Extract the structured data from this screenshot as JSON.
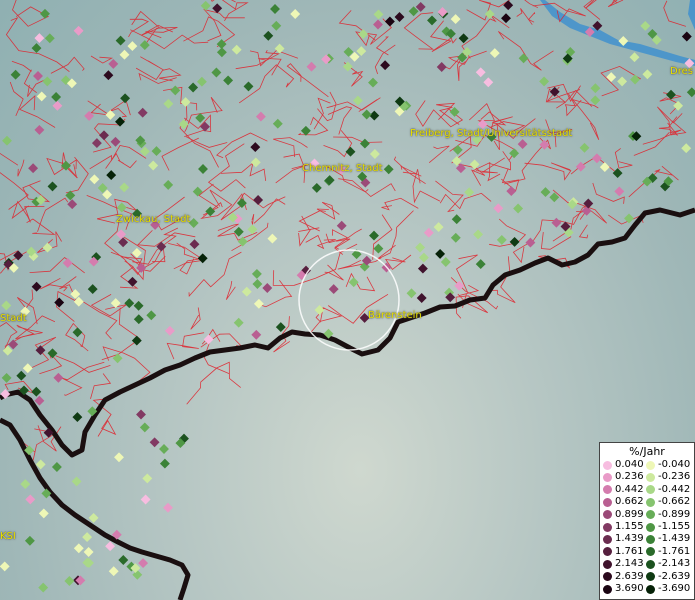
{
  "places": [
    {
      "id": "dresden",
      "label": "Dres"
    },
    {
      "id": "freiberg",
      "label": "Freiberg, Stadt/Universitätsstadt"
    },
    {
      "id": "chemnitz",
      "label": "Chemnitz, Stadt"
    },
    {
      "id": "zwickau",
      "label": "Zwickau, Stadt"
    },
    {
      "id": "baerenstein",
      "label": "Bärenstein"
    },
    {
      "id": "stadt-left",
      "label": "Stadt"
    },
    {
      "id": "ksi",
      "label": "KSI"
    }
  ],
  "legend": {
    "title": "%/Jahr",
    "positive": [
      {
        "value": "0.040",
        "color": "#f7bde0"
      },
      {
        "value": "0.236",
        "color": "#e99bc8"
      },
      {
        "value": "0.442",
        "color": "#d47cae"
      },
      {
        "value": "0.662",
        "color": "#b95f92"
      },
      {
        "value": "0.899",
        "color": "#9b4a78"
      },
      {
        "value": "1.155",
        "color": "#823a63"
      },
      {
        "value": "1.439",
        "color": "#6b2c50"
      },
      {
        "value": "1.761",
        "color": "#561f3e"
      },
      {
        "value": "2.143",
        "color": "#40132d"
      },
      {
        "value": "2.639",
        "color": "#2c0a1e"
      },
      {
        "value": "3.690",
        "color": "#1a0412"
      }
    ],
    "negative": [
      {
        "value": "-0.040",
        "color": "#eef7b6"
      },
      {
        "value": "-0.236",
        "color": "#cde99e"
      },
      {
        "value": "-0.442",
        "color": "#a9d888"
      },
      {
        "value": "-0.662",
        "color": "#86c46f"
      },
      {
        "value": "-0.899",
        "color": "#67ad58"
      },
      {
        "value": "-1.155",
        "color": "#4f9745"
      },
      {
        "value": "-1.439",
        "color": "#3b8237"
      },
      {
        "value": "-1.761",
        "color": "#2a6a2a"
      },
      {
        "value": "-2.143",
        "color": "#1c521f"
      },
      {
        "value": "-2.639",
        "color": "#0f3a13"
      },
      {
        "value": "-3.690",
        "color": "#062208"
      }
    ]
  },
  "colors": {
    "border_lines": "#e0202a",
    "national_border": "#1a0f10",
    "label_text": "#e8e000",
    "water": "#3b8fd0"
  }
}
